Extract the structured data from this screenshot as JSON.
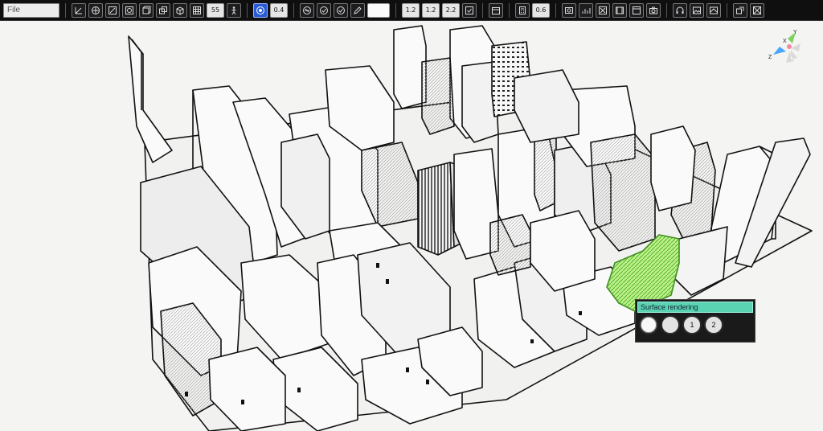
{
  "toolbar": {
    "file_placeholder": "File",
    "buttons": {
      "b1": "1.2",
      "b2": "1.2",
      "b3": "2.2",
      "zoom": "0.4",
      "count": "55",
      "speed": "0.6"
    }
  },
  "popup": {
    "title": "Surface rendering",
    "btn3": "1",
    "btn4": "2"
  },
  "axis": {
    "x": "X",
    "y": "Y",
    "z": "Z"
  }
}
